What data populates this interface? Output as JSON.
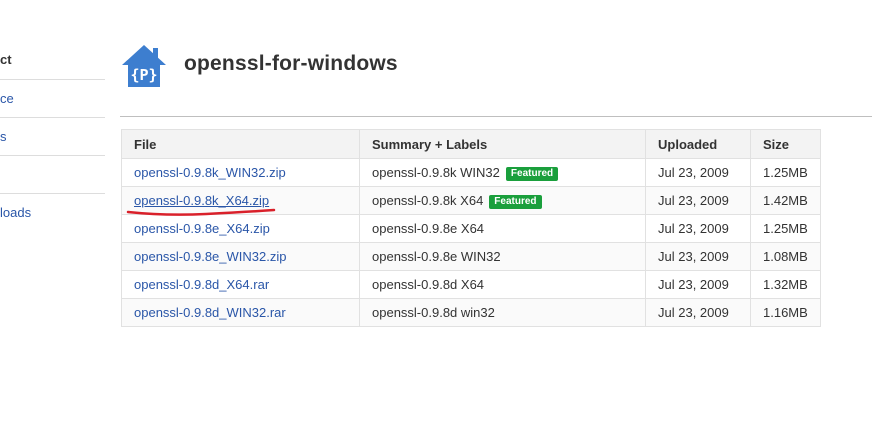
{
  "sidebar": {
    "items": [
      {
        "label": "ct"
      },
      {
        "label": "ce"
      },
      {
        "label": "s"
      },
      {
        "label": ""
      },
      {
        "label": "loads"
      }
    ]
  },
  "project": {
    "name": "openssl-for-windows",
    "logo_glyph": "{P}",
    "logo_icon": "project-house-logo",
    "logo_color": "#3d7ecf"
  },
  "downloads_table": {
    "columns": [
      "File",
      "Summary + Labels",
      "Uploaded",
      "Size"
    ],
    "rows": [
      {
        "file": "openssl-0.9.8k_WIN32.zip",
        "summary": "openssl-0.9.8k WIN32",
        "label": "Featured",
        "uploaded": "Jul 23, 2009",
        "size": "1.25MB"
      },
      {
        "file": "openssl-0.9.8k_X64.zip",
        "summary": "openssl-0.9.8k X64",
        "label": "Featured",
        "uploaded": "Jul 23, 2009",
        "size": "1.42MB"
      },
      {
        "file": "openssl-0.9.8e_X64.zip",
        "summary": "openssl-0.9.8e X64",
        "label": "",
        "uploaded": "Jul 23, 2009",
        "size": "1.25MB"
      },
      {
        "file": "openssl-0.9.8e_WIN32.zip",
        "summary": "openssl-0.9.8e WIN32",
        "label": "",
        "uploaded": "Jul 23, 2009",
        "size": "1.08MB"
      },
      {
        "file": "openssl-0.9.8d_X64.rar",
        "summary": "openssl-0.9.8d X64",
        "label": "",
        "uploaded": "Jul 23, 2009",
        "size": "1.32MB"
      },
      {
        "file": "openssl-0.9.8d_WIN32.rar",
        "summary": "openssl-0.9.8d win32",
        "label": "",
        "uploaded": "Jul 23, 2009",
        "size": "1.16MB"
      }
    ]
  },
  "colors": {
    "link": "#2a56a8",
    "featured_badge": "#1a9f3c",
    "annotation": "#d9202a"
  }
}
